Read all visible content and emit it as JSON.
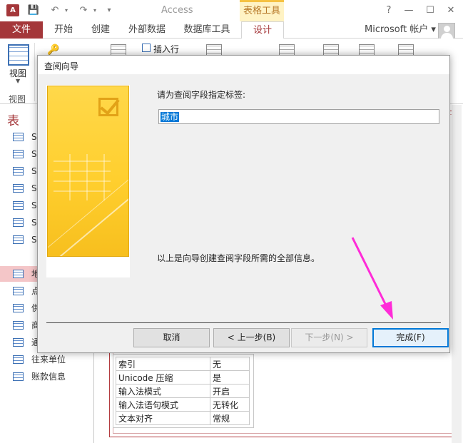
{
  "titlebar": {
    "app_icon": "A",
    "title": "Access",
    "contextual_tab": "表格工具",
    "help": "?",
    "minimize": "—",
    "maximize": "☐",
    "close": "✕"
  },
  "ribbon_tabs": {
    "file": "文件",
    "tabs": [
      "开始",
      "创建",
      "外部数据",
      "数据库工具",
      "设计"
    ],
    "account": "Microsoft 帐户 ▾"
  },
  "ribbon": {
    "view_label": "视图",
    "group_label": "视图",
    "insert_row": "插入行"
  },
  "nav": {
    "header": "表",
    "items": [
      {
        "label": "S"
      },
      {
        "label": "S"
      },
      {
        "label": "S"
      },
      {
        "label": "S"
      },
      {
        "label": "S"
      },
      {
        "label": "S"
      },
      {
        "label": "S"
      },
      {
        "label": "地"
      },
      {
        "label": "点"
      },
      {
        "label": "供"
      },
      {
        "label": "商"
      },
      {
        "label": "通"
      },
      {
        "label": "往来单位"
      },
      {
        "label": "账款信息"
      }
    ]
  },
  "properties": [
    {
      "key": "索引",
      "value": "无"
    },
    {
      "key": "Unicode 压缩",
      "value": "是"
    },
    {
      "key": "输入法模式",
      "value": "开启"
    },
    {
      "key": "输入法语句模式",
      "value": "无转化"
    },
    {
      "key": "文本对齐",
      "value": "常规"
    }
  ],
  "dialog": {
    "title": "查阅向导",
    "prompt": "请为查阅字段指定标签:",
    "label_value": "城市",
    "info": "以上是向导创建查阅字段所需的全部信息。",
    "buttons": {
      "cancel": "取消",
      "back": "< 上一步(B)",
      "next": "下一步(N) >",
      "finish": "完成(F)"
    }
  },
  "annotation_color": "#ff2bd8"
}
